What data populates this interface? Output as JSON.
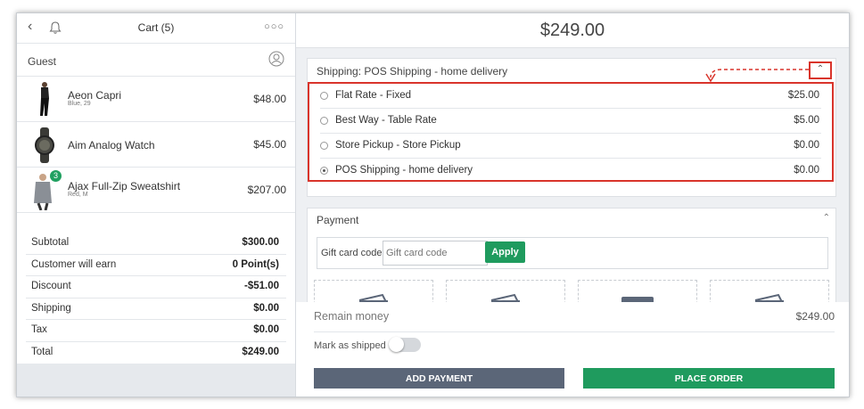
{
  "cart": {
    "title": "Cart (5)",
    "customer": "Guest",
    "items": [
      {
        "name": "Aeon Capri",
        "options": "Blue, 29",
        "price": "$48.00",
        "qty_badge": ""
      },
      {
        "name": "Aim Analog Watch",
        "options": "",
        "price": "$45.00",
        "qty_badge": ""
      },
      {
        "name": "Ajax Full-Zip Sweatshirt",
        "options": "Red, M",
        "price": "$207.00",
        "qty_badge": "3"
      }
    ],
    "totals": [
      {
        "label": "Subtotal",
        "value": "$300.00"
      },
      {
        "label": "Customer will earn",
        "value": "0 Point(s)"
      },
      {
        "label": "Discount",
        "value": "-$51.00"
      },
      {
        "label": "Shipping",
        "value": "$0.00"
      },
      {
        "label": "Tax",
        "value": "$0.00"
      },
      {
        "label": "Total",
        "value": "$249.00"
      }
    ]
  },
  "checkout": {
    "grand_total": "$249.00",
    "shipping": {
      "header": "Shipping: POS Shipping - home delivery",
      "options": [
        {
          "label": "Flat Rate - Fixed",
          "price": "$25.00",
          "selected": false
        },
        {
          "label": "Best Way - Table Rate",
          "price": "$5.00",
          "selected": false
        },
        {
          "label": "Store Pickup - Store Pickup",
          "price": "$0.00",
          "selected": false
        },
        {
          "label": "POS Shipping - home delivery",
          "price": "$0.00",
          "selected": true
        }
      ]
    },
    "payment": {
      "header": "Payment",
      "gift_label": "Gift card code",
      "gift_placeholder": "Gift card code",
      "apply_label": "Apply"
    },
    "remain_label": "Remain money",
    "remain_value": "$249.00",
    "mark_shipped_label": "Mark as shipped",
    "add_payment_label": "ADD PAYMENT",
    "place_order_label": "PLACE ORDER"
  },
  "colors": {
    "accent_green": "#1f9b5e",
    "highlight_red": "#d9342b",
    "dark_button": "#5b6678"
  }
}
